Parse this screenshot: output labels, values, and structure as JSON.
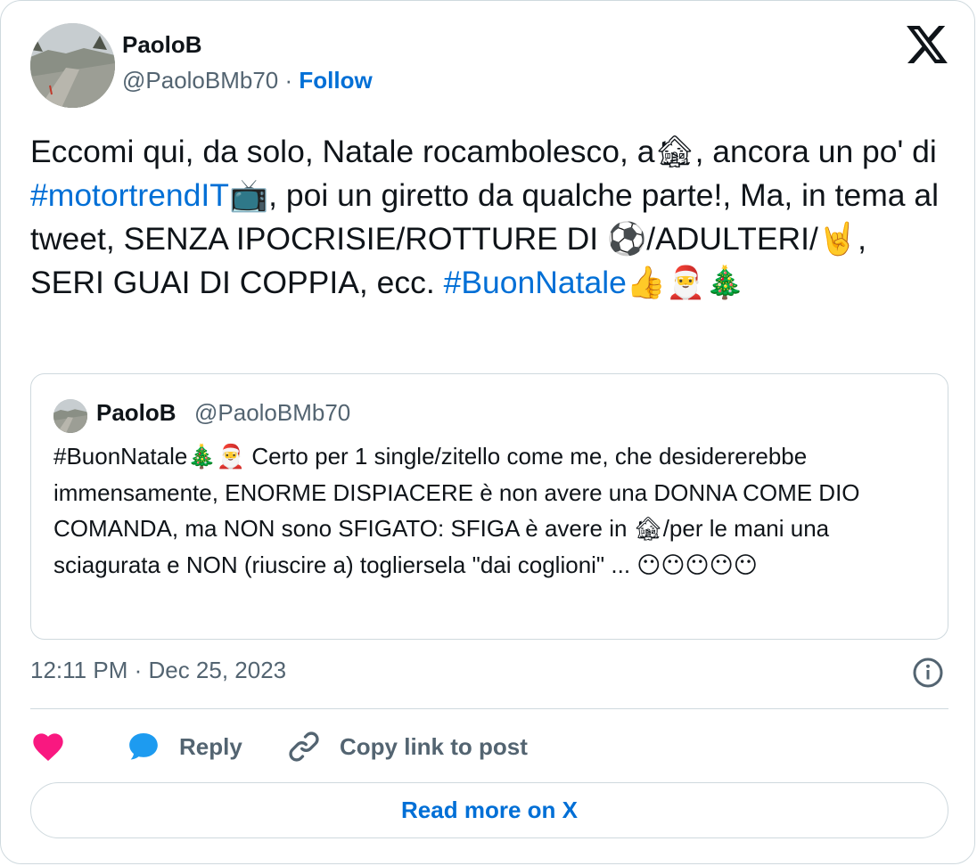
{
  "author": {
    "name": "PaoloB",
    "handle": "@PaoloBMb70",
    "separator": "·",
    "follow_label": "Follow"
  },
  "tweet": {
    "parts": [
      {
        "t": "Eccomi qui, da solo, Natale rocambolesco, a"
      },
      {
        "e": "🏚"
      },
      {
        "t": ", ancora un po' di "
      },
      {
        "h": "#motortrendIT"
      },
      {
        "e": "📺"
      },
      {
        "t": ", poi un giretto da qualche parte!, Ma, in tema al tweet, SENZA IPOCRISIE/ROTTURE DI "
      },
      {
        "e": "⚽"
      },
      {
        "t": "/ADULTERI/"
      },
      {
        "e": "🤘"
      },
      {
        "t": ", SERI GUAI DI COPPIA, ecc. "
      },
      {
        "h": "#BuonNatale"
      },
      {
        "e": "👍"
      },
      {
        "e": "🎅"
      },
      {
        "e": "🎄"
      }
    ]
  },
  "quote": {
    "name": "PaoloB",
    "handle": "@PaoloBMb70",
    "parts": [
      {
        "t": "#BuonNatale"
      },
      {
        "e": "🎄"
      },
      {
        "e": "🎅"
      },
      {
        "t": " Certo per 1 single/zitello come me, che desidererebbe immensamente, ENORME DISPIACERE è non avere una DONNA COME DIO COMANDA, ma NON sono SFIGATO: SFIGA è avere in "
      },
      {
        "e": "🏚"
      },
      {
        "t": "/per le mani una sciagurata e NON (riuscire a) togliersela \"dai coglioni\" ... "
      },
      {
        "e": "😶😶😶😶😶"
      }
    ]
  },
  "meta": {
    "timestamp": "12:11 PM · Dec 25, 2023"
  },
  "actions": {
    "reply_label": "Reply",
    "copy_label": "Copy link to post"
  },
  "footer": {
    "read_more_label": "Read more on X"
  },
  "colors": {
    "link": "#006fd6",
    "muted": "#536471",
    "text": "#0f1419",
    "like": "#f91880",
    "reply_icon": "#1d9bf0",
    "border": "#cfd9de"
  },
  "icons": {
    "logo": "x-logo-icon",
    "info": "info-icon",
    "like": "heart-icon",
    "reply": "speech-bubble-icon",
    "copy": "link-icon"
  }
}
